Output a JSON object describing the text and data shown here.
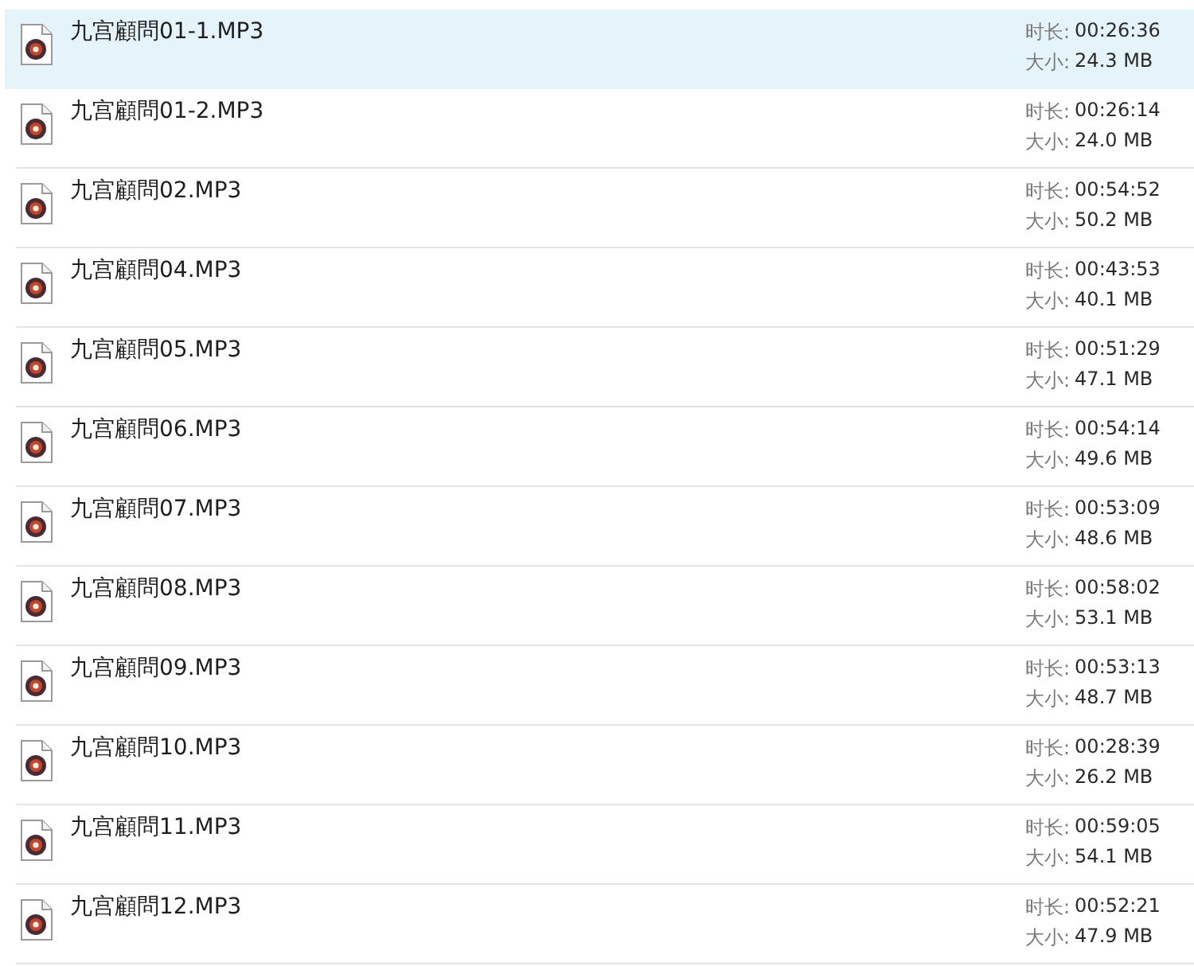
{
  "files": [
    {
      "name": "九宫顧問01-1.MP3",
      "selected": true,
      "duration_label": "时长:",
      "duration": "00:26:36",
      "size_label": "大小:",
      "size": "24.3 MB"
    },
    {
      "name": "九宫顧問01-2.MP3",
      "selected": false,
      "duration_label": "时长:",
      "duration": "00:26:14",
      "size_label": "大小:",
      "size": "24.0 MB"
    },
    {
      "name": "九宫顧問02.MP3",
      "selected": false,
      "duration_label": "时长:",
      "duration": "00:54:52",
      "size_label": "大小:",
      "size": "50.2 MB"
    },
    {
      "name": "九宫顧問04.MP3",
      "selected": false,
      "duration_label": "时长:",
      "duration": "00:43:53",
      "size_label": "大小:",
      "size": "40.1 MB"
    },
    {
      "name": "九宫顧問05.MP3",
      "selected": false,
      "duration_label": "时长:",
      "duration": "00:51:29",
      "size_label": "大小:",
      "size": "47.1 MB"
    },
    {
      "name": "九宫顧問06.MP3",
      "selected": false,
      "duration_label": "时长:",
      "duration": "00:54:14",
      "size_label": "大小:",
      "size": "49.6 MB"
    },
    {
      "name": "九宫顧問07.MP3",
      "selected": false,
      "duration_label": "时长:",
      "duration": "00:53:09",
      "size_label": "大小:",
      "size": "48.6 MB"
    },
    {
      "name": "九宫顧問08.MP3",
      "selected": false,
      "duration_label": "时长:",
      "duration": "00:58:02",
      "size_label": "大小:",
      "size": "53.1 MB"
    },
    {
      "name": "九宫顧問09.MP3",
      "selected": false,
      "duration_label": "时长:",
      "duration": "00:53:13",
      "size_label": "大小:",
      "size": "48.7 MB"
    },
    {
      "name": "九宫顧問10.MP3",
      "selected": false,
      "duration_label": "时长:",
      "duration": "00:28:39",
      "size_label": "大小:",
      "size": "26.2 MB"
    },
    {
      "name": "九宫顧問11.MP3",
      "selected": false,
      "duration_label": "时长:",
      "duration": "00:59:05",
      "size_label": "大小:",
      "size": "54.1 MB"
    },
    {
      "name": "九宫顧問12.MP3",
      "selected": false,
      "duration_label": "时长:",
      "duration": "00:52:21",
      "size_label": "大小:",
      "size": "47.9 MB"
    }
  ]
}
